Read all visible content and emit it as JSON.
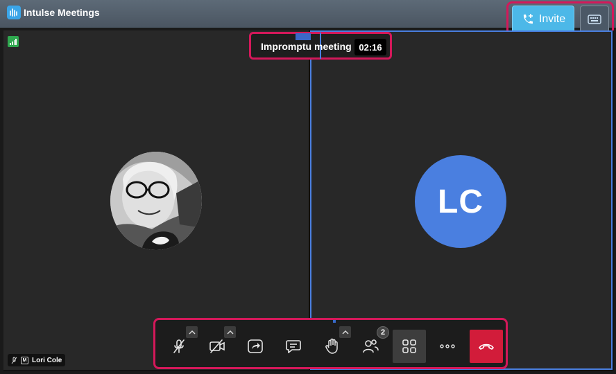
{
  "app": {
    "title": "Intulse Meetings"
  },
  "header": {
    "invite_label": "Invite"
  },
  "meeting": {
    "title": "Impromptu meeting",
    "duration": "02:16"
  },
  "participants": [
    {
      "name": "Lori Cole",
      "moderator_badge": "M"
    },
    {
      "initials": "LC"
    }
  ],
  "toolbar": {
    "participants_count": "2"
  },
  "colors": {
    "accent": "#4cb8e8",
    "avatar_bg": "#4a7fe0",
    "hangup": "#d21c3a",
    "highlight": "#d4185a"
  }
}
